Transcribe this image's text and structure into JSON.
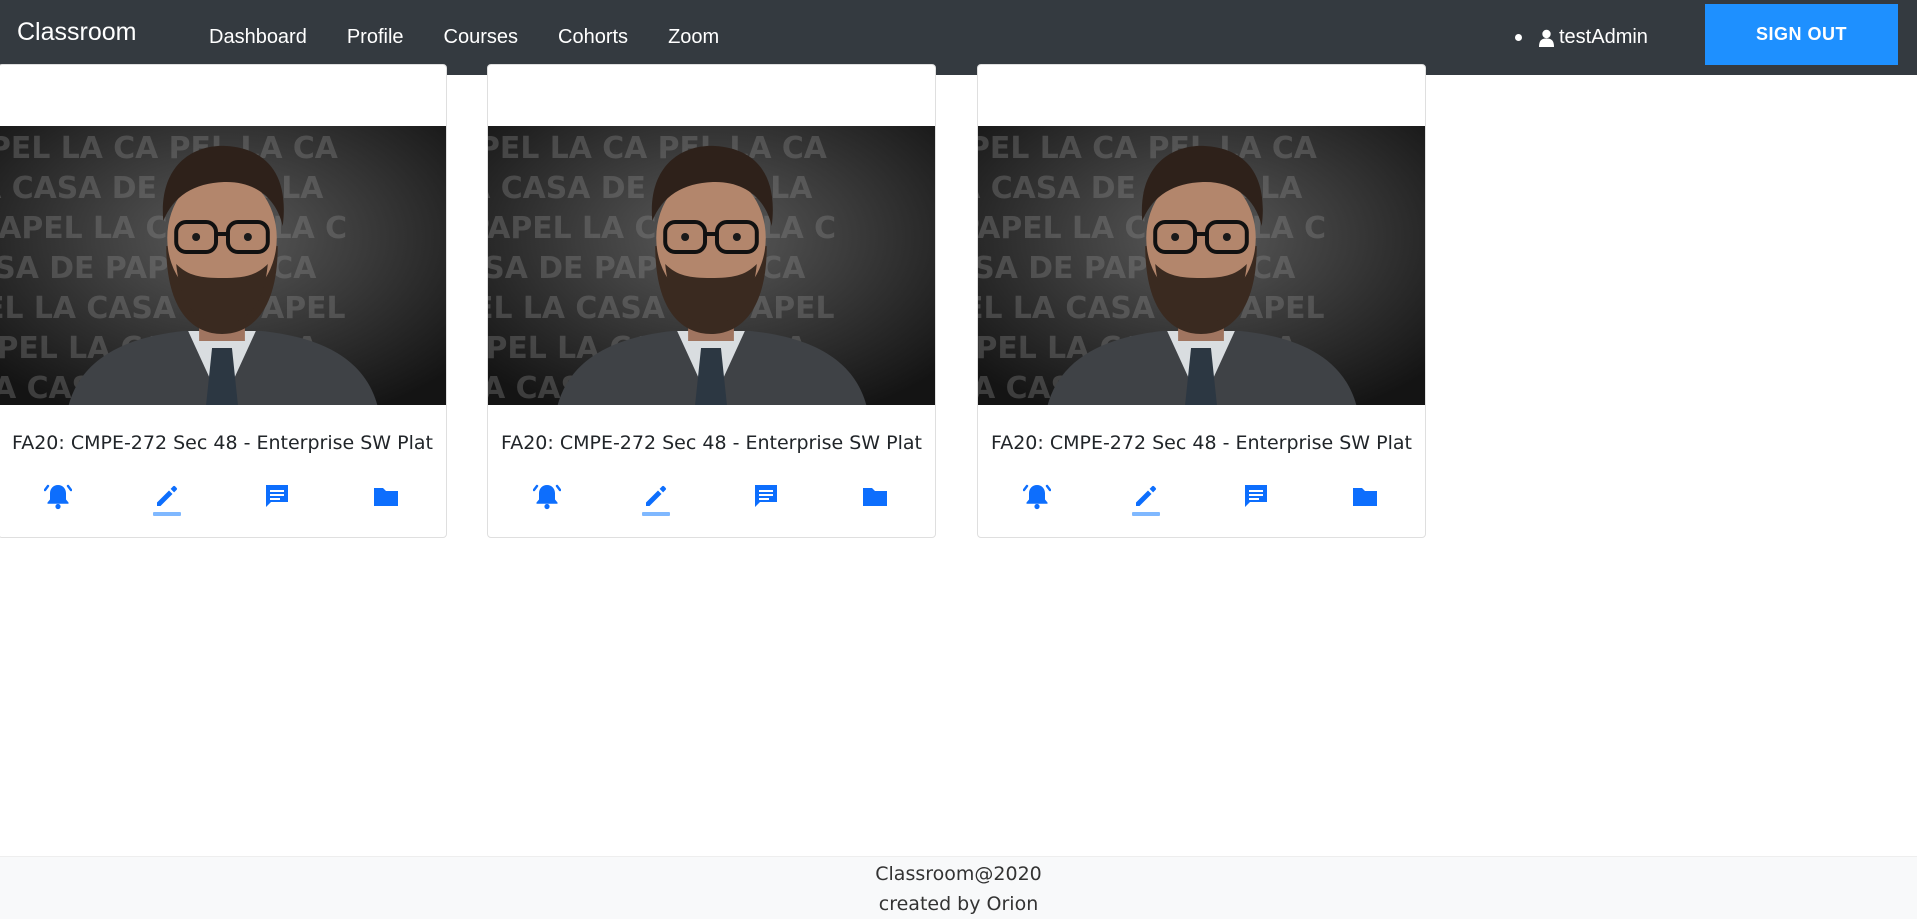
{
  "navbar": {
    "brand": "Classroom",
    "links": [
      "Dashboard",
      "Profile",
      "Courses",
      "Cohorts",
      "Zoom"
    ],
    "user": "testAdmin",
    "signout_label": "SIGN OUT"
  },
  "cards": [
    {
      "title": "FA20: CMPE-272 Sec 48 - Enterprise SW Plat",
      "image": "professor-portrait"
    },
    {
      "title": "FA20: CMPE-272 Sec 48 - Enterprise SW Plat",
      "image": "professor-portrait"
    },
    {
      "title": "FA20: CMPE-272 Sec 48 - Enterprise SW Plat",
      "image": "professor-portrait"
    }
  ],
  "card_actions": [
    "bell-icon",
    "pencil-icon",
    "chat-icon",
    "folder-icon"
  ],
  "colors": {
    "navbar": "#343a40",
    "accent": "#1e90ff",
    "icon": "#0d6efd"
  },
  "footer": {
    "line1": "Classroom@2020",
    "line2": "created by Orion"
  }
}
